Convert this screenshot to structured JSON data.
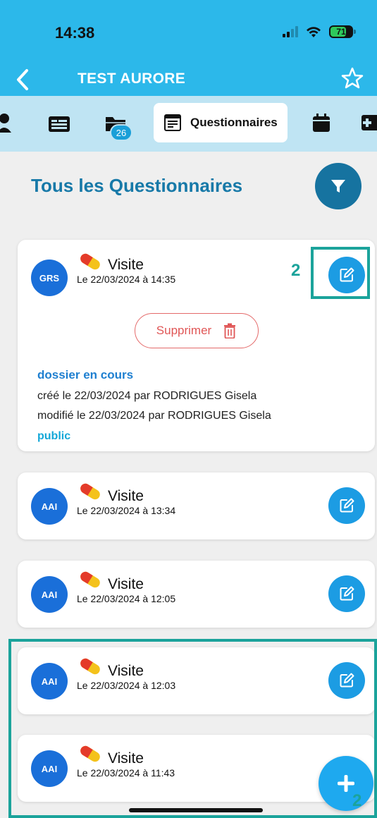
{
  "status_bar": {
    "time": "14:38",
    "battery": "71"
  },
  "nav": {
    "title": "TEST AURORE"
  },
  "tabs": {
    "active_label": "Questionnaires",
    "folder_badge": "26"
  },
  "section": {
    "title": "Tous les Questionnaires"
  },
  "cards": [
    {
      "avatar": "GRS",
      "title": "Visite",
      "date": "Le 22/03/2024 à 14:35",
      "delete_label": "Supprimer",
      "status": "dossier en cours",
      "created": "créé le 22/03/2024 par RODRIGUES Gisela",
      "modified": "modifié le 22/03/2024 par RODRIGUES Gisela",
      "visibility": "public"
    },
    {
      "avatar": "AAI",
      "title": "Visite",
      "date": "Le 22/03/2024 à 13:34"
    },
    {
      "avatar": "AAI",
      "title": "Visite",
      "date": "Le 22/03/2024 à 12:05"
    },
    {
      "avatar": "AAI",
      "title": "Visite",
      "date": "Le 22/03/2024 à 12:03"
    },
    {
      "avatar": "AAI",
      "title": "Visite",
      "date": "Le 22/03/2024 à 11:43"
    }
  ],
  "annotations": {
    "edit_marker": "2",
    "list_marker": "2"
  },
  "colors": {
    "header": "#2cb8ea",
    "tabs_bg": "#bfe4f3",
    "title": "#1779a8",
    "accent": "#1c9ce3",
    "annotation": "#1ba39b",
    "delete": "#e05656"
  },
  "icons": [
    "back-chevron-icon",
    "star-icon",
    "person-icon",
    "id-card-icon",
    "folder-icon",
    "questionnaire-icon",
    "calendar-icon",
    "filter-icon",
    "pill-icon",
    "edit-icon",
    "trash-icon",
    "plus-icon"
  ]
}
